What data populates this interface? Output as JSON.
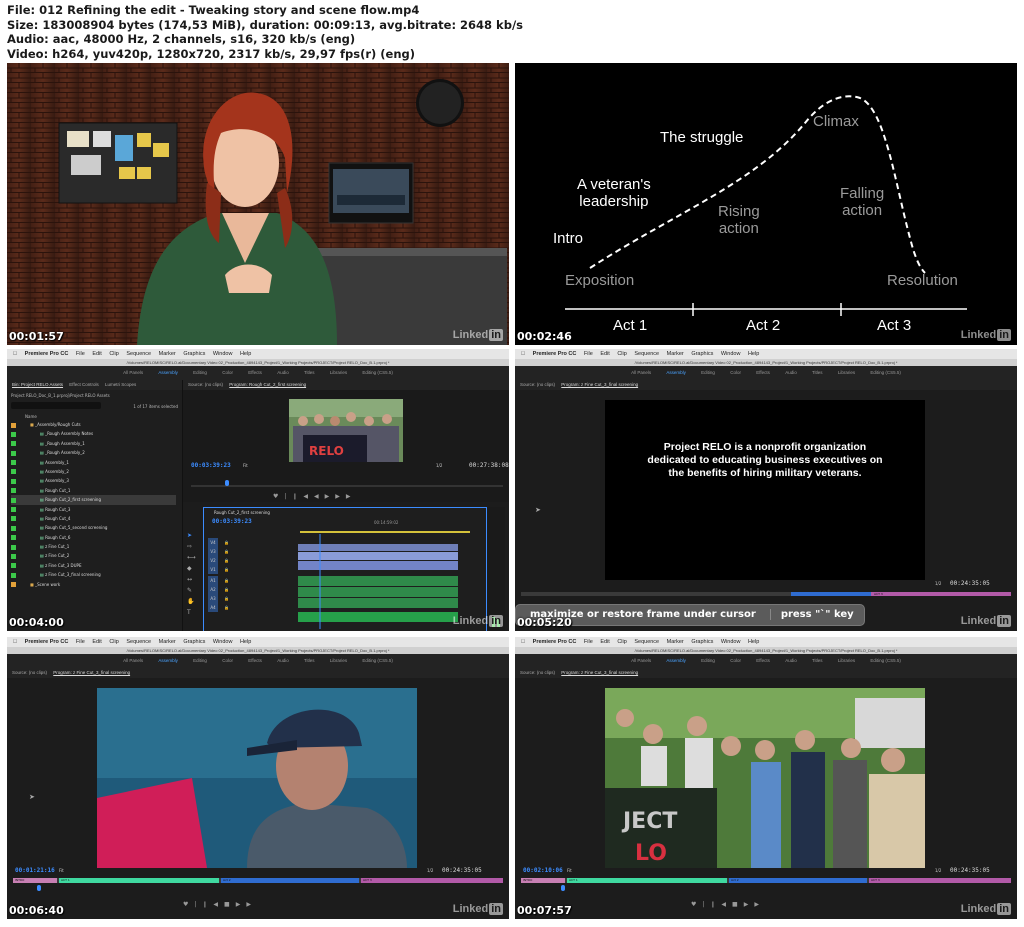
{
  "header": {
    "line1": "File: 012 Refining the edit - Tweaking story and scene flow.mp4",
    "line2": "Size: 183008904 bytes (174,53 MiB), duration: 00:09:13, avg.bitrate: 2648 kb/s",
    "line3": "Audio: aac, 48000 Hz, 2 channels, s16, 320 kb/s (eng)",
    "line4": "Video: h264, yuv420p, 1280x720, 2317 kb/s, 29,97 fps(r) (eng)"
  },
  "watermark": {
    "text": "Linked",
    "badge": "in"
  },
  "frames": [
    {
      "timestamp": "00:01:57"
    },
    {
      "timestamp": "00:02:46",
      "story_arc": {
        "intro": "Intro",
        "leadership_1": "A veteran's",
        "leadership_2": "leadership",
        "struggle": "The struggle",
        "climax": "Climax",
        "rising_1": "Rising",
        "rising_2": "action",
        "falling_1": "Falling",
        "falling_2": "action",
        "exposition": "Exposition",
        "resolution": "Resolution",
        "act1": "Act 1",
        "act2": "Act 2",
        "act3": "Act 3"
      }
    },
    {
      "timestamp": "00:04:00",
      "app": {
        "name": "Premiere Pro CC",
        "menu": [
          "File",
          "Edit",
          "Clip",
          "Sequence",
          "Marker",
          "Graphics",
          "Window",
          "Help"
        ],
        "path": "/Volumes/RELOMISC/RELO.al/Documentary Video 02_Production_4894143_Project/1_Working Projects/PROJECT/Project RELO_Doc_B.1.prproj *",
        "workspaces": [
          "All Panels",
          "Assembly",
          "Editing",
          "Color",
          "Effects",
          "Audio",
          "Titles",
          "Libraries",
          "Editing (CS5.5)"
        ],
        "active_workspace": "Assembly"
      },
      "project_panel": {
        "tabs": [
          "Bin: Project RELO Assets",
          "Effect Controls",
          "Lumetri Scopes"
        ],
        "breadcrumb": "Project RELO_Doc_B_1.prproj\\Project RELO Assets",
        "count": "1 of 17 items selected",
        "col_name": "Name",
        "folder": "_Assembly/Rough Cuts",
        "items": [
          "_Rough Assembly Notes",
          "_Rough Assembly_1",
          "_Rough Assembly_2",
          "Assembly_1",
          "Assembly_2",
          "Assembly_3",
          "Rough Cut_1",
          "Rough Cut_2_first screening",
          "Rough Cut_3",
          "Rough Cut_4",
          "Rough Cut_5_second screening",
          "Rough Cut_6",
          "z Fine Cut_1",
          "z Fine Cut_2",
          "z Fine Cut_3 DUPE",
          "z Fine Cut_3_final screening"
        ],
        "selected_index": 7,
        "folder2": "_Scene work"
      },
      "source_tab": "Source: (no clips)",
      "program_tab": "Program: Rough Cut_2_first screening",
      "program_tc": "00:03:39:23",
      "program_fit": "Fit",
      "program_ratio": "1/2",
      "program_duration": "00:27:38:08",
      "timeline": {
        "tab": "Rough Cut_2_first screening",
        "tc": "00:03:39:23",
        "ruler_label": "00:14:59:02",
        "video_tracks": [
          "V4",
          "V3",
          "V2",
          "V1"
        ],
        "audio_tracks": [
          "A1",
          "A2",
          "A3",
          "A4"
        ]
      }
    },
    {
      "timestamp": "00:05:20",
      "program_tab": "Program: z Fine Cut_3_final screening",
      "source_tab": "Source: (no clips)",
      "title_card": "Project RELO is a nonprofit organization dedicated to educating business executives on the benefits of hiring military veterans.",
      "tooltip_action": "maximize or restore frame under cursor",
      "tooltip_key": "press \"`\" key",
      "program_ratio": "1/2",
      "program_duration": "00:24:35:05",
      "act_label": "ACT 3"
    },
    {
      "timestamp": "00:06:40",
      "program_tab": "Program: z Fine Cut_3_final screening",
      "source_tab": "Source: (no clips)",
      "program_tc": "00:01:21:16",
      "program_fit": "Fit",
      "program_ratio": "1/2",
      "program_duration": "00:24:35:05",
      "markers": [
        "INTRO",
        "ACT 1",
        "Act 2",
        "ACT 3"
      ]
    },
    {
      "timestamp": "00:07:57",
      "program_tab": "Program: z Fine Cut_3_final screening",
      "source_tab": "Source: (no clips)",
      "program_tc": "00:02:10:06",
      "program_fit": "Fit",
      "program_ratio": "1/2",
      "program_duration": "00:24:35:05",
      "markers": [
        "INTRO",
        "ACT 1",
        "Act 2",
        "ACT 3"
      ]
    }
  ],
  "colors": {
    "premiere_blue": "#3c8cff",
    "marker_intro": "#c77fb3",
    "marker_act1": "#3fd9a0",
    "marker_act2": "#2f6cd0",
    "marker_act3": "#b25aa8"
  }
}
